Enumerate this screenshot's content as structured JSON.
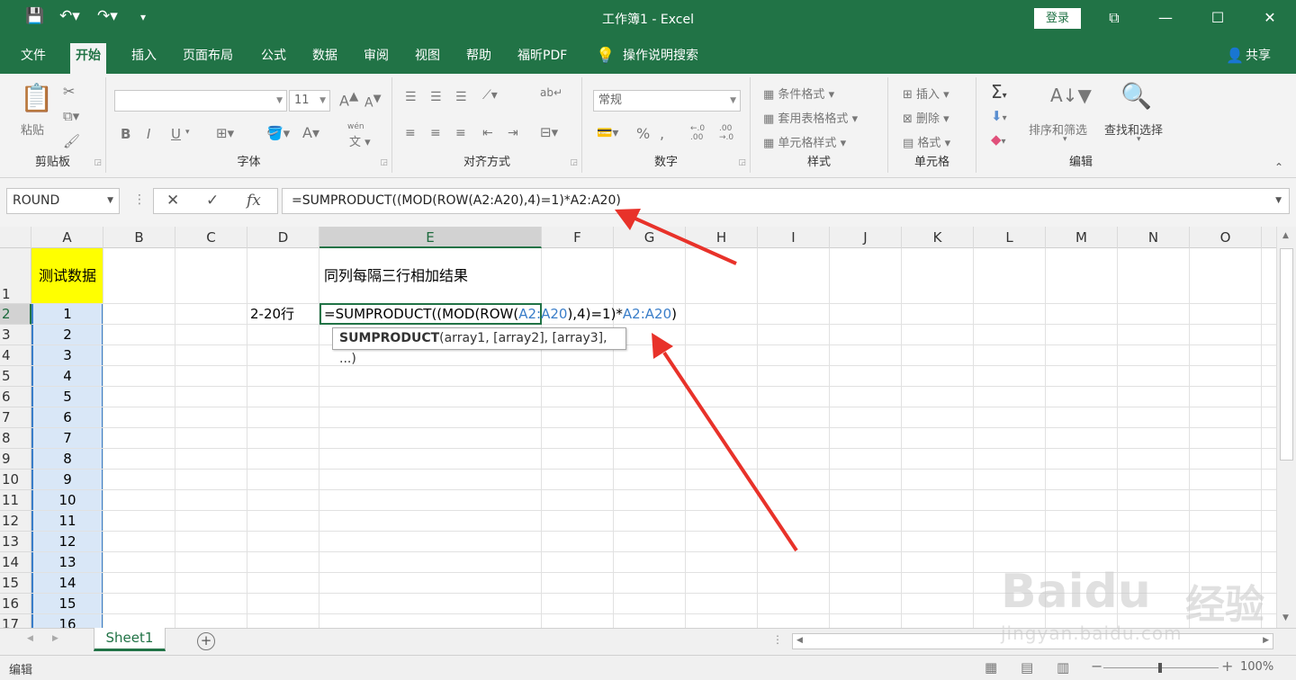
{
  "window": {
    "title": "工作簿1  -  Excel",
    "login_label": "登录"
  },
  "menu": {
    "tabs": [
      "文件",
      "开始",
      "插入",
      "页面布局",
      "公式",
      "数据",
      "审阅",
      "视图",
      "帮助",
      "福昕PDF"
    ],
    "active_tab": "开始",
    "tell_me": "操作说明搜索",
    "share": "共享"
  },
  "ribbon": {
    "clipboard": {
      "label": "剪贴板",
      "paste": "粘贴"
    },
    "font": {
      "label": "字体",
      "font_name": "",
      "font_size": "11",
      "bold": "B",
      "italic": "I",
      "underline": "U",
      "phonetic": "wén"
    },
    "alignment": {
      "label": "对齐方式"
    },
    "number": {
      "label": "数字",
      "format": "常规",
      "percent": "%"
    },
    "styles": {
      "label": "样式",
      "conditional": "条件格式",
      "table": "套用表格格式",
      "cell_styles": "单元格样式"
    },
    "cells": {
      "label": "单元格",
      "insert": "插入",
      "delete": "删除",
      "format": "格式"
    },
    "editing": {
      "label": "编辑",
      "sort": "排序和筛选",
      "find": "查找和选择"
    }
  },
  "formula_bar": {
    "name_box": "ROUND",
    "formula": "=SUMPRODUCT((MOD(ROW(A2:A20),4)=1)*A2:A20)"
  },
  "grid": {
    "columns": [
      "A",
      "B",
      "C",
      "D",
      "E",
      "F",
      "G",
      "H",
      "I",
      "J",
      "K",
      "L",
      "M",
      "N",
      "O"
    ],
    "rows": [
      "1",
      "2",
      "3",
      "4",
      "5",
      "6",
      "7",
      "8",
      "9",
      "10",
      "11",
      "12",
      "13",
      "14",
      "15",
      "16",
      "17"
    ],
    "a1_header": "测试数据",
    "a_values": [
      "1",
      "2",
      "3",
      "4",
      "5",
      "6",
      "7",
      "8",
      "9",
      "10",
      "11",
      "12",
      "13",
      "14",
      "15",
      "16"
    ],
    "e1_text": "同列每隔三行相加结果",
    "d2_text": "2-20行",
    "edit_parts": {
      "p1": "=SUMPRODUCT((MOD(ROW(",
      "p2": "A2:A20",
      "p3": "),4)=1)*",
      "p4": "A2:A20",
      "p5": ")"
    },
    "colors": {
      "header_fill": "#ffff00",
      "range_fill": "#d9e7f7",
      "ref1": "#3a7ec9",
      "accent": "#217346",
      "arrow": "#e8322a"
    }
  },
  "tooltip": {
    "func": "SUMPRODUCT",
    "args": "(array1, [array2], [array3], ...)"
  },
  "sheets": {
    "tabs": [
      "Sheet1"
    ]
  },
  "status": {
    "mode": "编辑",
    "zoom": "100%"
  },
  "watermark": {
    "brand": "Baidu",
    "brand_cn": "经验",
    "url": "jingyan.baidu.com"
  }
}
